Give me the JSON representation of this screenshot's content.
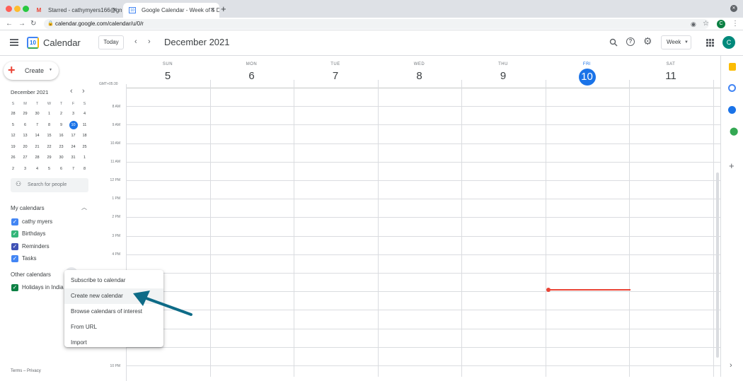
{
  "browser": {
    "tabs": [
      {
        "title": "Starred - cathymyers166@gm…",
        "favicon": "M"
      },
      {
        "title": "Google Calendar - Week of 5 D…",
        "favicon": "10"
      }
    ],
    "url": "calendar.google.com/calendar/u/0/r",
    "profile_initial": "C"
  },
  "header": {
    "app_name": "Calendar",
    "logo_day": "10",
    "today_label": "Today",
    "period_title": "December 2021",
    "view_label": "Week",
    "avatar_initial": "C"
  },
  "sidebar": {
    "create_label": "Create",
    "mini_calendar": {
      "title": "December 2021",
      "dow": [
        "S",
        "M",
        "T",
        "W",
        "T",
        "F",
        "S"
      ],
      "weeks": [
        [
          "28",
          "29",
          "30",
          "1",
          "2",
          "3",
          "4"
        ],
        [
          "5",
          "6",
          "7",
          "8",
          "9",
          "10",
          "11"
        ],
        [
          "12",
          "13",
          "14",
          "15",
          "16",
          "17",
          "18"
        ],
        [
          "19",
          "20",
          "21",
          "22",
          "23",
          "24",
          "25"
        ],
        [
          "26",
          "27",
          "28",
          "29",
          "30",
          "31",
          "1"
        ],
        [
          "2",
          "3",
          "4",
          "5",
          "6",
          "7",
          "8"
        ]
      ],
      "selected": "10"
    },
    "search_people_placeholder": "Search for people",
    "my_calendars_title": "My calendars",
    "my_calendars": [
      {
        "label": "cathy myers",
        "color": "#4285f4"
      },
      {
        "label": "Birthdays",
        "color": "#33b679"
      },
      {
        "label": "Reminders",
        "color": "#3f51b5"
      },
      {
        "label": "Tasks",
        "color": "#4285f4"
      }
    ],
    "other_calendars_title": "Other calendars",
    "other_calendars": [
      {
        "label": "Holidays in India",
        "color": "#0b8043"
      }
    ],
    "footer": {
      "terms": "Terms",
      "separator": "–",
      "privacy": "Privacy"
    }
  },
  "week": {
    "timezone": "GMT+05:30",
    "days": [
      {
        "dow": "SUN",
        "num": "5"
      },
      {
        "dow": "MON",
        "num": "6"
      },
      {
        "dow": "TUE",
        "num": "7"
      },
      {
        "dow": "WED",
        "num": "8"
      },
      {
        "dow": "THU",
        "num": "9"
      },
      {
        "dow": "FRI",
        "num": "10",
        "today": true
      },
      {
        "dow": "SAT",
        "num": "11"
      }
    ],
    "times": [
      "8 AM",
      "9 AM",
      "10 AM",
      "11 AM",
      "12 PM",
      "1 PM",
      "2 PM",
      "3 PM",
      "4 PM",
      "10 PM"
    ]
  },
  "context_menu": {
    "items": [
      "Subscribe to calendar",
      "Create new calendar",
      "Browse calendars of interest",
      "From URL",
      "Import"
    ],
    "highlighted": "Create new calendar"
  },
  "colors": {
    "accent": "#1a73e8",
    "now_line": "#ea4335",
    "annotation_arrow": "#0e6b87"
  }
}
